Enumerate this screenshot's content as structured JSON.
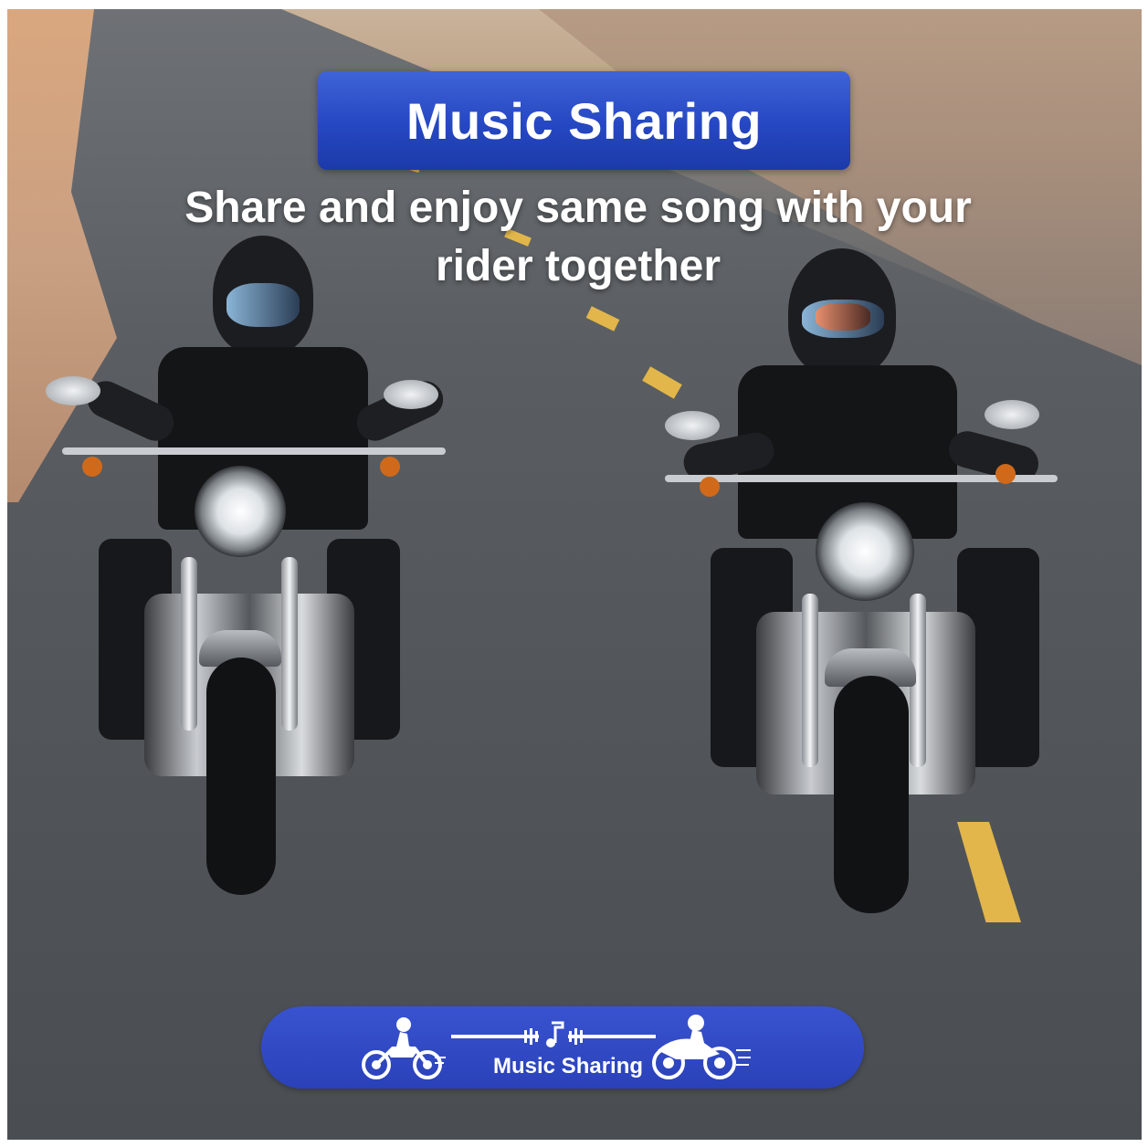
{
  "headline": {
    "title": "Music Sharing",
    "subtitle_line1": "Share and enjoy same song with your",
    "subtitle_line2": "rider together"
  },
  "banner": {
    "label": "Music Sharing",
    "left_icon": "motorcycle-rider-icon",
    "center_icon": "music-note-icon",
    "right_icon": "motorcycle-rider-icon"
  },
  "colors": {
    "accent_blue": "#2547c2",
    "banner_blue": "#2f46bf",
    "lane_yellow": "#e2b64a",
    "text": "#ffffff"
  }
}
